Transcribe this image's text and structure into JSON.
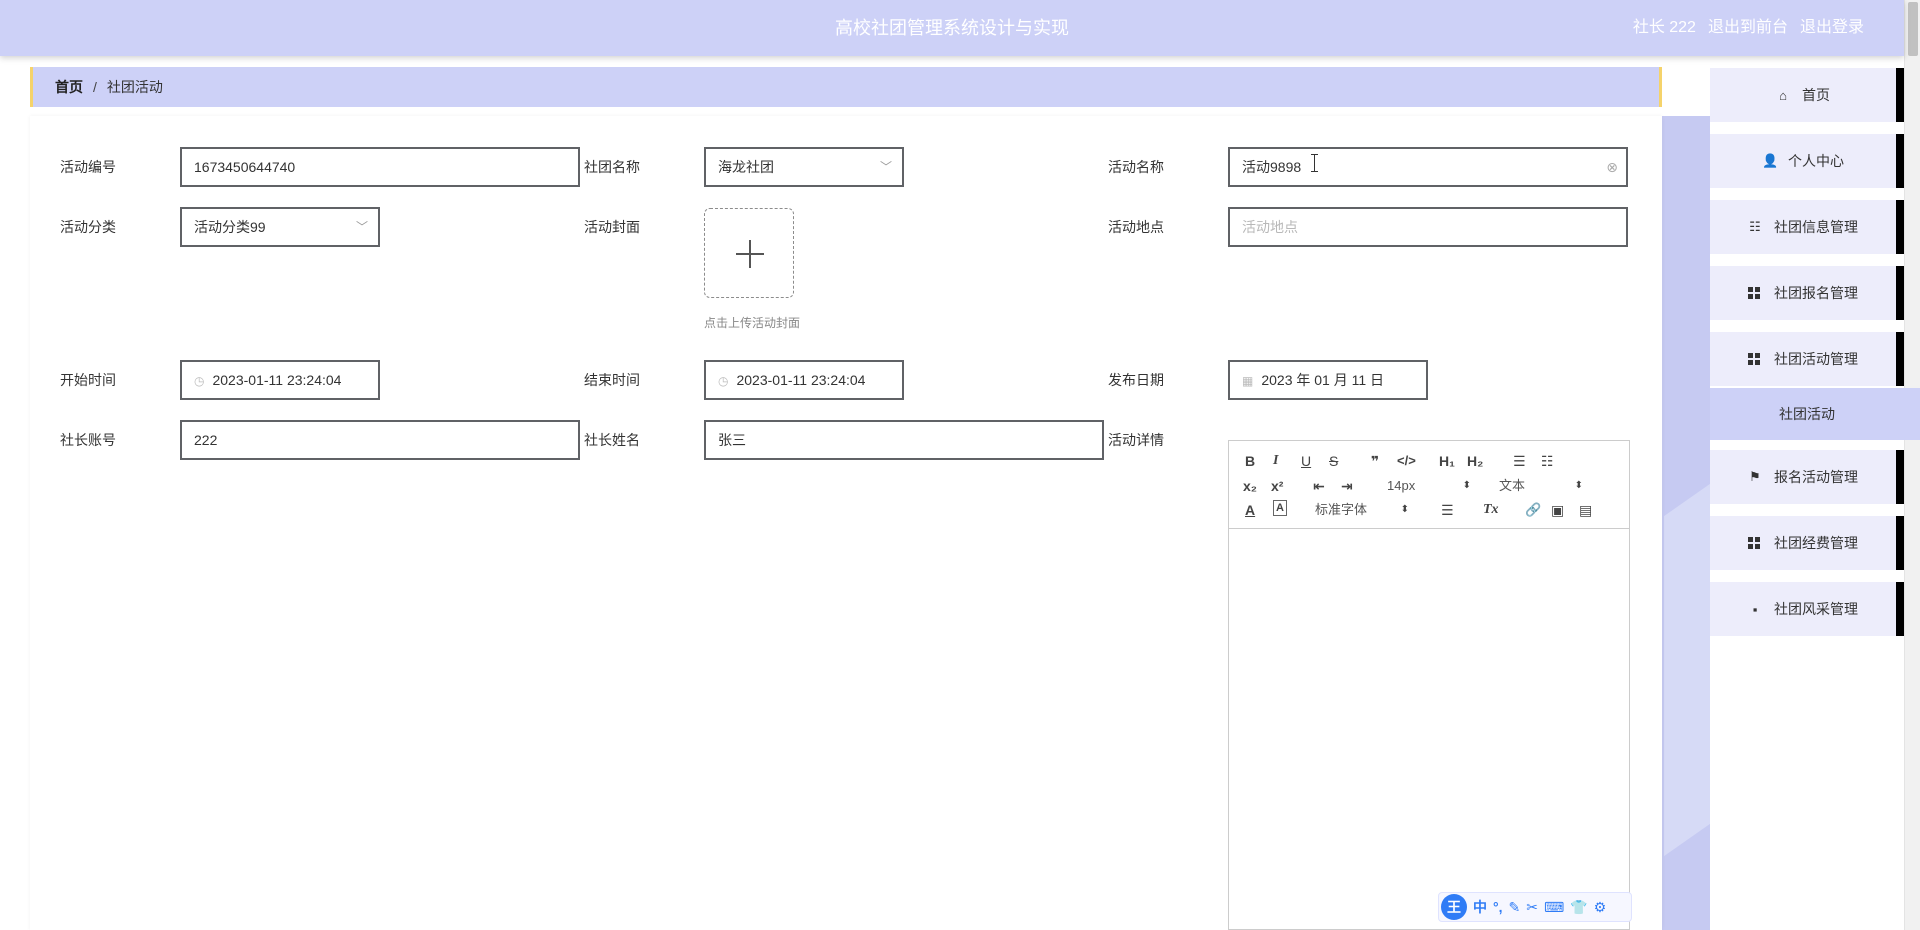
{
  "header": {
    "title": "高校社团管理系统设计与实现",
    "user": "社长 222",
    "to_front": "退出到前台",
    "logout": "退出登录"
  },
  "breadcrumb": {
    "home": "首页",
    "separator": "/",
    "current": "社团活动"
  },
  "form": {
    "activity_no": {
      "label": "活动编号",
      "value": "1673450644740"
    },
    "club_name": {
      "label": "社团名称",
      "value": "海龙社团"
    },
    "activity_name": {
      "label": "活动名称",
      "value": "活动9898"
    },
    "activity_category": {
      "label": "活动分类",
      "value": "活动分类99"
    },
    "activity_cover": {
      "label": "活动封面",
      "hint": "点击上传活动封面"
    },
    "activity_location": {
      "label": "活动地点",
      "placeholder": "活动地点"
    },
    "start_time": {
      "label": "开始时间",
      "value": "2023-01-11 23:24:04"
    },
    "end_time": {
      "label": "结束时间",
      "value": "2023-01-11 23:24:04"
    },
    "publish_date": {
      "label": "发布日期",
      "value": "2023 年 01 月 11 日"
    },
    "leader_account": {
      "label": "社长账号",
      "value": "222"
    },
    "leader_name": {
      "label": "社长姓名",
      "value": "张三"
    },
    "activity_detail": {
      "label": "活动详情"
    }
  },
  "editor": {
    "bold": "B",
    "italic": "I",
    "underline": "U",
    "strike": "S",
    "quote": "❞",
    "code": "</>",
    "h1": "H₁",
    "h2": "H₂",
    "ordered_list": "☰",
    "bullet_list": "☷",
    "sub": "x₂",
    "sup": "x²",
    "outdent": "⇤",
    "indent": "⇥",
    "size_select": "14px",
    "text_select": "文本",
    "color": "A",
    "bg": "A",
    "font_select": "标准字体",
    "align": "☰",
    "clear": "Tx",
    "link": "🔗",
    "image": "▣",
    "video": "▤",
    "updown": "⬍"
  },
  "ime": {
    "logo": "王",
    "items": [
      "中",
      "°,",
      "✎",
      "✂",
      "⌨",
      "👕",
      "⚙"
    ]
  },
  "menu": {
    "items": [
      {
        "label": "首页",
        "icon": "home-icon",
        "glyph": "⌂"
      },
      {
        "label": "个人中心",
        "icon": "user-icon",
        "glyph": "👤"
      },
      {
        "label": "社团信息管理",
        "icon": "sliders-icon",
        "glyph": "☷"
      },
      {
        "label": "社团报名管理",
        "icon": "grid-icon",
        "glyph": ""
      },
      {
        "label": "社团活动管理",
        "icon": "grid-icon",
        "glyph": ""
      },
      {
        "label": "报名活动管理",
        "icon": "flag-icon",
        "glyph": "⚑"
      },
      {
        "label": "社团经费管理",
        "icon": "grid-icon",
        "glyph": ""
      },
      {
        "label": "社团风采管理",
        "icon": "comment-icon",
        "glyph": "▪"
      }
    ],
    "sub_item": "社团活动"
  },
  "colors": {
    "header_bg": "#cdd1f7",
    "menu_bg": "#ededfb",
    "accent_border": "#f5d36b"
  }
}
